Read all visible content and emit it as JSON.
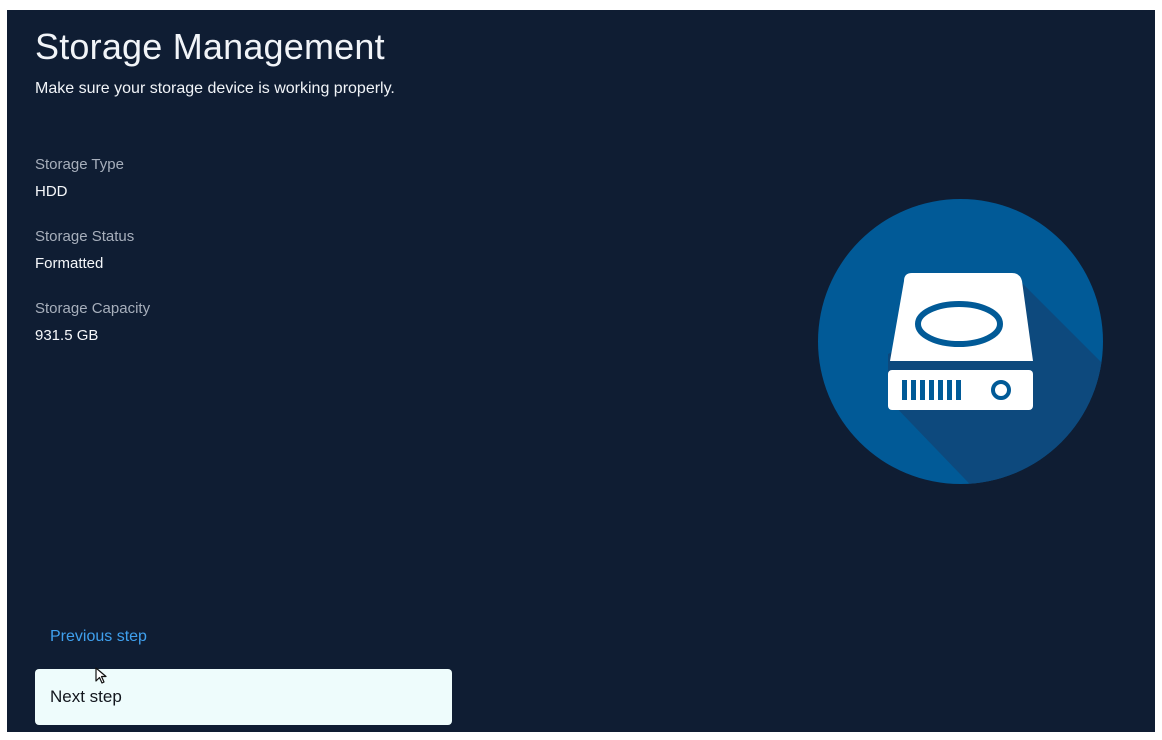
{
  "header": {
    "title": "Storage Management",
    "subtitle": "Make sure your storage device is working properly."
  },
  "storage_info": [
    {
      "label": "Storage Type",
      "value": "HDD"
    },
    {
      "label": "Storage Status",
      "value": "Formatted"
    },
    {
      "label": "Storage Capacity",
      "value": "931.5 GB"
    }
  ],
  "illustration": {
    "icon": "hard-drive-icon",
    "circle_color": "#015a97",
    "shadow_color": "#0f4778",
    "drive_color": "#ffffff"
  },
  "footer": {
    "previous_label": "Previous step",
    "next_label": "Next step"
  },
  "colors": {
    "background": "#0f1d33",
    "text": "#f1f4f8",
    "label": "#a7afbc",
    "link": "#3fa0ee",
    "button_background": "#eefcfc"
  }
}
